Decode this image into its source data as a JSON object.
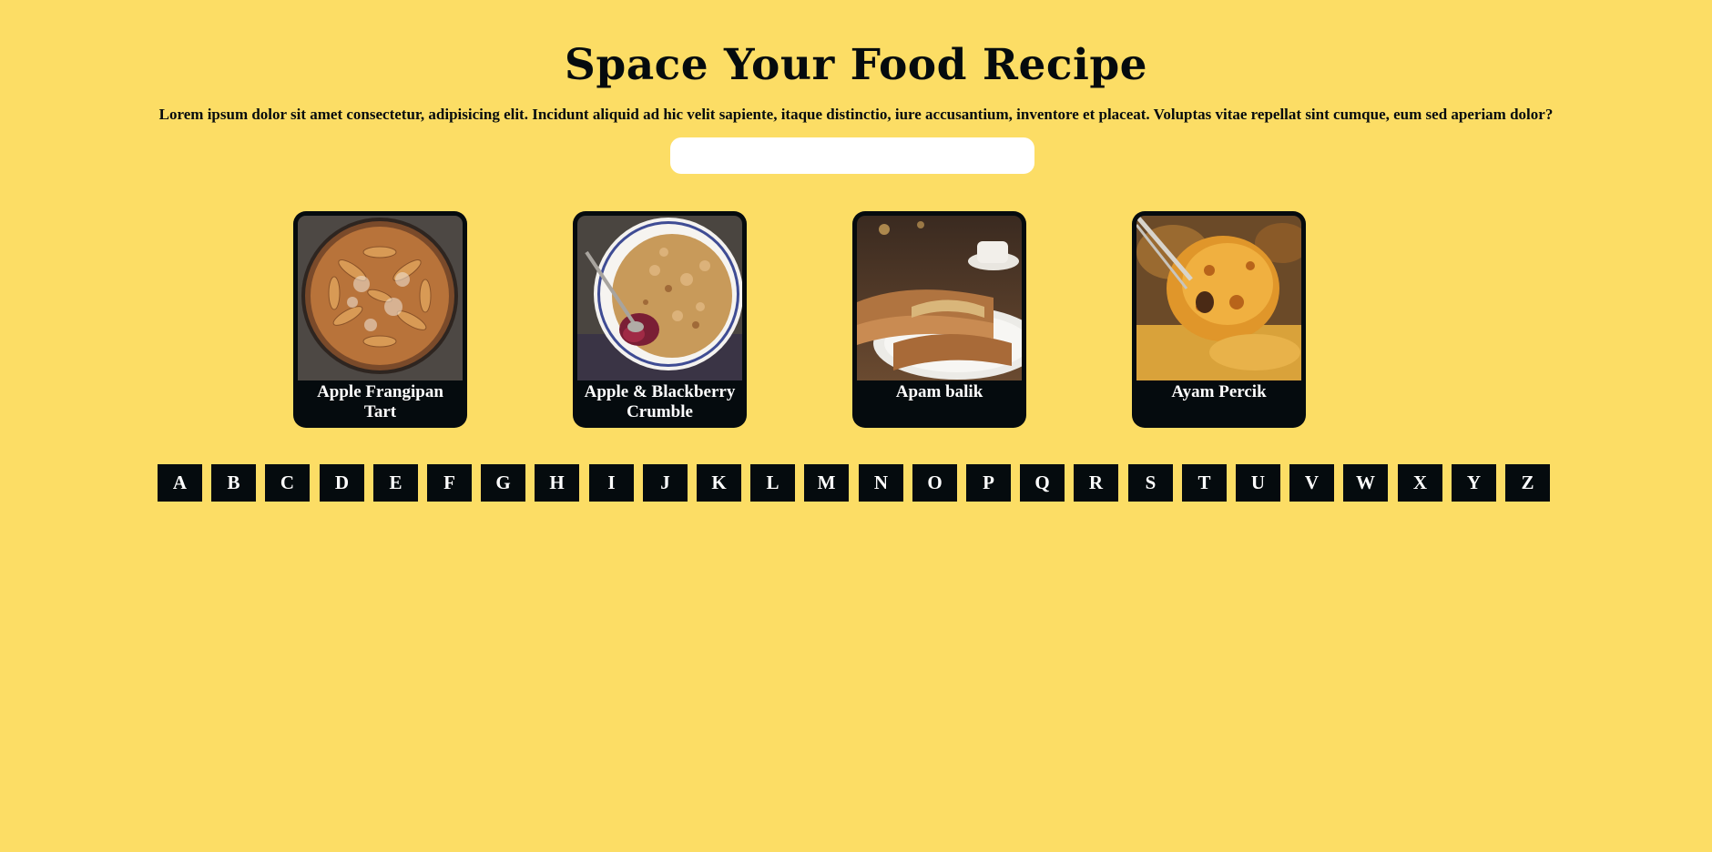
{
  "header": {
    "title": "Space Your Food Recipe",
    "subtitle": "Lorem ipsum dolor sit amet consectetur, adipisicing elit. Incidunt aliquid ad hic velit sapiente, itaque distinctio, iure accusantium, inventore et placeat. Voluptas vitae repellat sint cumque, eum sed aperiam dolor?"
  },
  "search": {
    "placeholder": "",
    "value": ""
  },
  "recipes": [
    {
      "name": "Apple Frangipan Tart"
    },
    {
      "name": "Apple & Blackberry Crumble"
    },
    {
      "name": "Apam balik"
    },
    {
      "name": "Ayam Percik"
    }
  ],
  "alphabet": [
    "A",
    "B",
    "C",
    "D",
    "E",
    "F",
    "G",
    "H",
    "I",
    "J",
    "K",
    "L",
    "M",
    "N",
    "O",
    "P",
    "Q",
    "R",
    "S",
    "T",
    "U",
    "V",
    "W",
    "X",
    "Y",
    "Z"
  ],
  "colors": {
    "background": "#fcdd65",
    "card": "#050b0e",
    "letter_button": "#050b0e",
    "text_light": "#ffffff"
  }
}
